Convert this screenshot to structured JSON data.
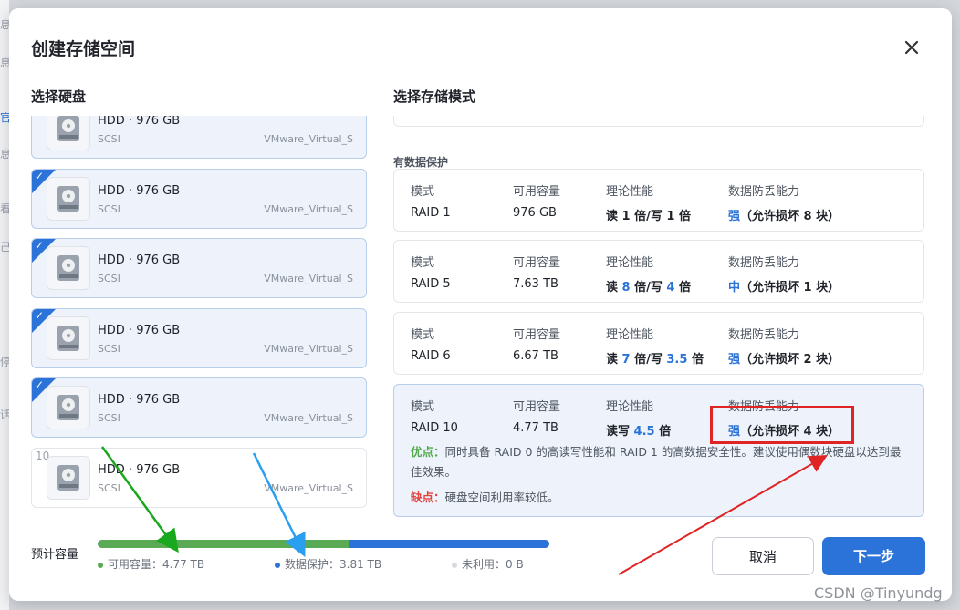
{
  "dialog": {
    "title": "创建存储空间",
    "close_icon": "close-icon"
  },
  "background_glyphs": [
    "息",
    "息",
    "官",
    "息",
    "看",
    "己",
    "停",
    "话"
  ],
  "disk_section": {
    "title": "选择硬盘",
    "disks": [
      {
        "name": "HDD · 976 GB",
        "bus": "SCSI",
        "model": "VMware_Virtual_S",
        "selected": true,
        "number": ""
      },
      {
        "name": "HDD · 976 GB",
        "bus": "SCSI",
        "model": "VMware_Virtual_S",
        "selected": true,
        "number": ""
      },
      {
        "name": "HDD · 976 GB",
        "bus": "SCSI",
        "model": "VMware_Virtual_S",
        "selected": true,
        "number": ""
      },
      {
        "name": "HDD · 976 GB",
        "bus": "SCSI",
        "model": "VMware_Virtual_S",
        "selected": true,
        "number": ""
      },
      {
        "name": "HDD · 976 GB",
        "bus": "SCSI",
        "model": "VMware_Virtual_S",
        "selected": true,
        "number": ""
      },
      {
        "name": "HDD · 976 GB",
        "bus": "SCSI",
        "model": "VMware_Virtual_S",
        "selected": false,
        "number": "10"
      }
    ]
  },
  "mode_section": {
    "title": "选择存储模式",
    "group_label": "有数据保护",
    "headers": {
      "mode": "模式",
      "capacity": "可用容量",
      "performance": "理论性能",
      "protection": "数据防丢能力"
    },
    "cards": [
      {
        "mode": "RAID 1",
        "capacity": "976 GB",
        "perf": {
          "p1": "读 ",
          "n1": "1",
          "p2": " 倍/写 ",
          "n2": "1",
          "p3": " 倍"
        },
        "prot_level": "强",
        "prot_text": "（允许损坏 8 块）",
        "selected": false
      },
      {
        "mode": "RAID 5",
        "capacity": "7.63 TB",
        "perf": {
          "p1": "读 ",
          "n1": "8",
          "p2": " 倍/写 ",
          "n2": "4",
          "p3": " 倍"
        },
        "prot_level": "中",
        "prot_text": "（允许损坏 1 块）",
        "selected": false
      },
      {
        "mode": "RAID 6",
        "capacity": "6.67 TB",
        "perf": {
          "p1": "读 ",
          "n1": "7",
          "p2": " 倍/写 ",
          "n2": "3.5",
          "p3": " 倍"
        },
        "prot_level": "强",
        "prot_text": "（允许损坏 2 块）",
        "selected": false
      },
      {
        "mode": "RAID 10",
        "capacity": "4.77 TB",
        "perf": {
          "p1": "读写 ",
          "n1": "4.5",
          "p2": " 倍",
          "n2": "",
          "p3": ""
        },
        "prot_level": "强",
        "prot_text": "（允许损坏 4 块）",
        "selected": true,
        "pros_label": "优点：",
        "pros_text": "同时具备 RAID 0 的高读写性能和 RAID 1 的高数据安全性。建议使用偶数块硬盘以达到最佳效果。",
        "cons_label": "缺点：",
        "cons_text": "硬盘空间利用率较低。"
      }
    ]
  },
  "footer": {
    "estimate_label": "预计容量",
    "available": {
      "label": "可用容量：",
      "value": "4.77 TB",
      "tb": 4.77,
      "color": "#5aaa55"
    },
    "protection": {
      "label": "数据保护：",
      "value": "3.81 TB",
      "tb": 3.81,
      "color": "#2b72d9"
    },
    "unused": {
      "label": "未利用：",
      "value": "0 B",
      "tb": 0,
      "color": "#d7dbe0"
    },
    "cancel_label": "取消",
    "next_label": "下一步"
  },
  "colors": {
    "accent": "#2b72d9",
    "selected_bg": "#eef3fb",
    "annotation_red": "#e02424",
    "arrow_green": "#19a81e",
    "arrow_blue": "#2a9ff0"
  },
  "watermark": "CSDN @Tinyundg"
}
